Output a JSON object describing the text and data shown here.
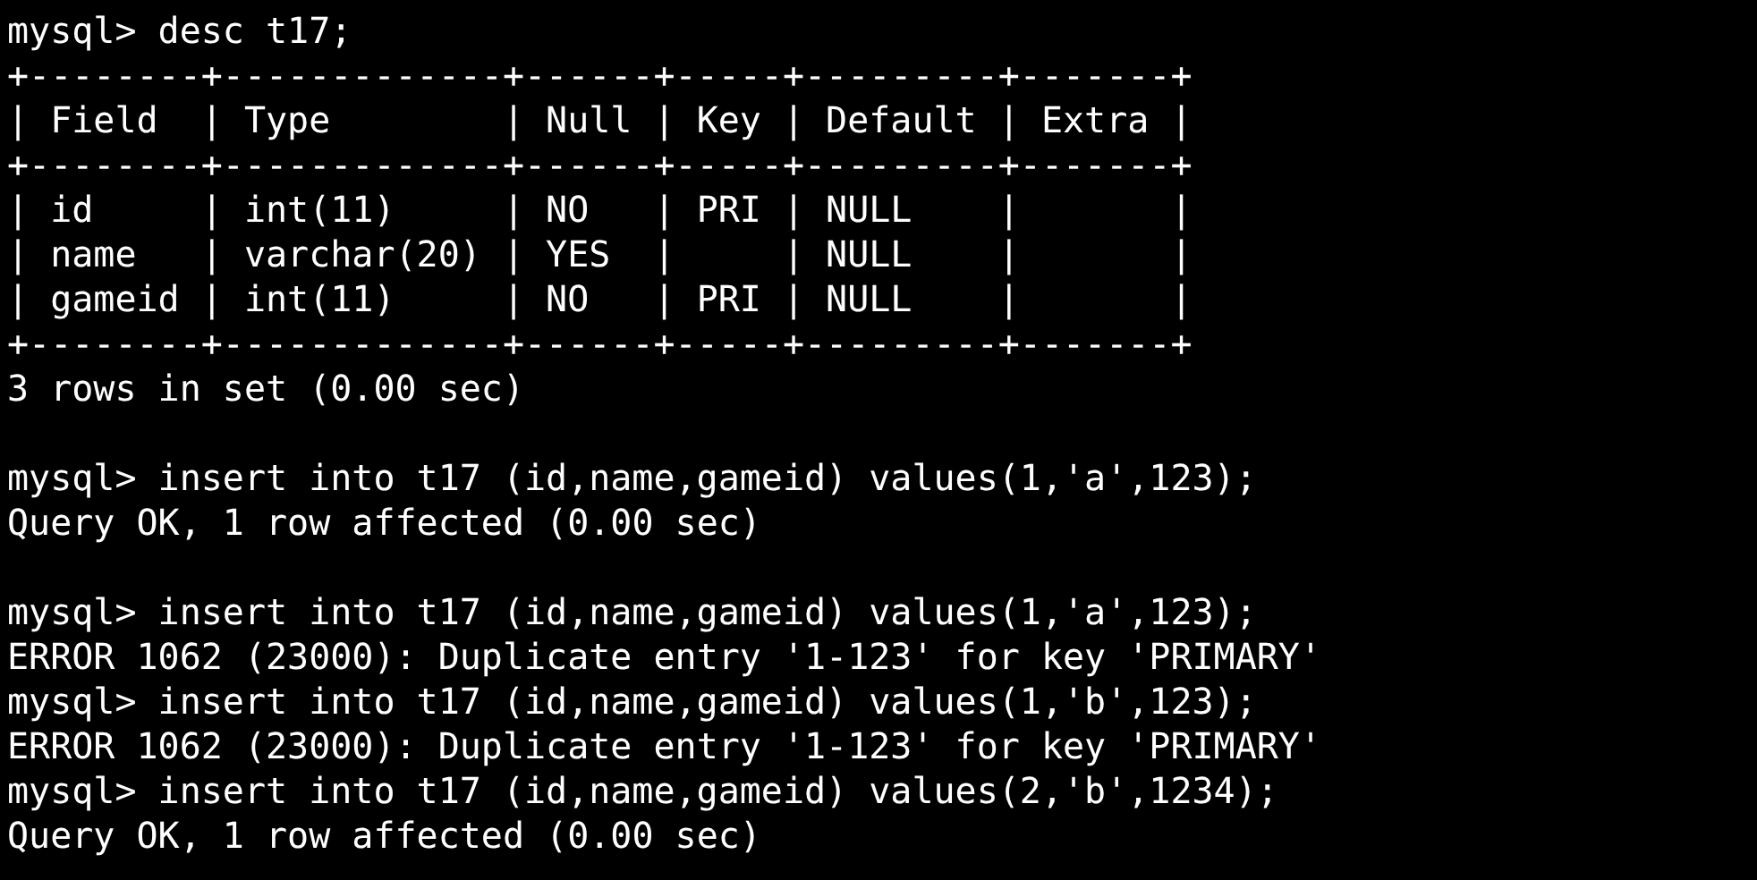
{
  "terminal": {
    "entries": [
      {
        "prompt": "mysql>",
        "command": "desc t17;",
        "blank_after": true,
        "output": [
          "+--------+-------------+------+-----+---------+-------+",
          "| Field  | Type        | Null | Key | Default | Extra |",
          "+--------+-------------+------+-----+---------+-------+",
          "| id     | int(11)     | NO   | PRI | NULL    |       |",
          "| name   | varchar(20) | YES  |     | NULL    |       |",
          "| gameid | int(11)     | NO   | PRI | NULL    |       |",
          "+--------+-------------+------+-----+---------+-------+",
          "3 rows in set (0.00 sec)"
        ]
      },
      {
        "prompt": "mysql>",
        "command": "insert into t17 (id,name,gameid) values(1,'a',123);",
        "blank_after": true,
        "output": [
          "Query OK, 1 row affected (0.00 sec)"
        ]
      },
      {
        "prompt": "mysql>",
        "command": "insert into t17 (id,name,gameid) values(1,'a',123);",
        "blank_after": false,
        "output": [
          "ERROR 1062 (23000): Duplicate entry '1-123' for key 'PRIMARY'"
        ]
      },
      {
        "prompt": "mysql>",
        "command": "insert into t17 (id,name,gameid) values(1,'b',123);",
        "blank_after": false,
        "output": [
          "ERROR 1062 (23000): Duplicate entry '1-123' for key 'PRIMARY'"
        ]
      },
      {
        "prompt": "mysql>",
        "command": "insert into t17 (id,name,gameid) values(2,'b',1234);",
        "blank_after": false,
        "output": [
          "Query OK, 1 row affected (0.00 sec)"
        ]
      }
    ]
  }
}
